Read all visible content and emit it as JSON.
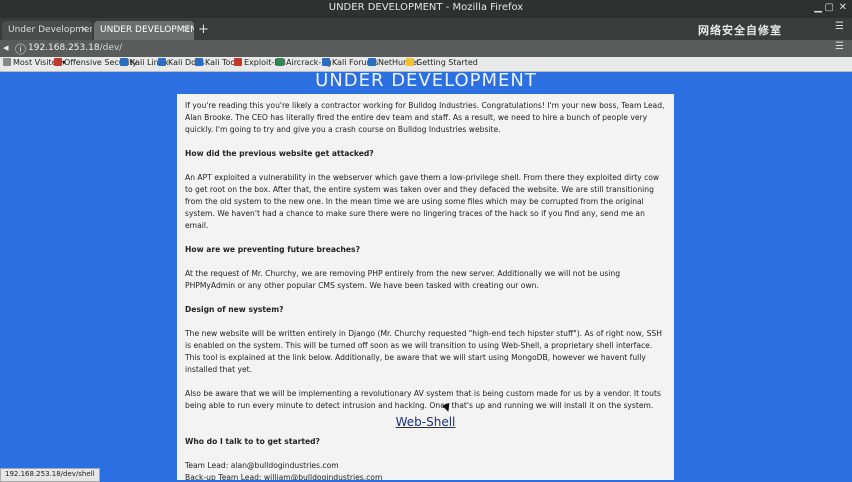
{
  "window": {
    "title": "UNDER DEVELOPMENT - Mozilla Firefox"
  },
  "tabs": [
    {
      "label": "Under Development"
    },
    {
      "label": "UNDER DEVELOPMENT"
    }
  ],
  "watermark": "网络安全自修室",
  "address": {
    "host": "192.168.253.18",
    "path": "/dev/"
  },
  "bookmarks": [
    {
      "label": "Most Visited▾",
      "icon": "gear-icon"
    },
    {
      "label": "Offensive Security",
      "icon": "offsec-icon"
    },
    {
      "label": "Kali Linux",
      "icon": "kali-icon"
    },
    {
      "label": "Kali Docs",
      "icon": "kali-icon"
    },
    {
      "label": "Kali Tools",
      "icon": "kali-icon"
    },
    {
      "label": "Exploit-DB",
      "icon": "exploitdb-icon"
    },
    {
      "label": "Aircrack-ng",
      "icon": "aircrack-icon"
    },
    {
      "label": "Kali Forums",
      "icon": "kali-icon"
    },
    {
      "label": "NetHunter",
      "icon": "kali-icon"
    },
    {
      "label": "Getting Started",
      "icon": "firefox-icon"
    }
  ],
  "page": {
    "heading": "UNDER DEVELOPMENT",
    "intro": "If you're reading this you're likely a contractor working for Bulldog Industries. Congratulations! I'm your new boss, Team Lead, Alan Brooke. The CEO has literally fired the entire dev team and staff. As a result, we need to hire a bunch of people very quickly. I'm going to try and give you a crash course on Bulldog Industries website.",
    "q1": "How did the previous website get attacked?",
    "a1": "An APT exploited a vulnerability in the webserver which gave them a low-privilege shell. From there they exploited dirty cow to get root on the box. After that, the entire system was taken over and they defaced the website. We are still transitioning from the old system to the new one. In the mean time we are using some files which may be corrupted from the original system. We haven't had a chance to make sure there were no lingering traces of the hack so if you find any, send me an email.",
    "q2": "How are we preventing future breaches?",
    "a2": "At the request of Mr. Churchy, we are removing PHP entirely from the new server. Additionally we will not be using PHPMyAdmin or any other popular CMS system. We have been tasked with creating our own.",
    "q3": "Design of new system?",
    "a3": "The new website will be written entirely in Django (Mr. Churchy requested \"high-end tech hipster stuff\"). As of right now, SSH is enabled on the system. This will be turned off soon as we will transition to using Web-Shell, a proprietary shell interface. This tool is explained at the link below. Additionally, be aware that we will start using MongoDB, however we havent fully installed that yet.",
    "a4": "Also be aware that we will be implementing a revolutionary AV system that is being custom made for us by a vendor. It touts being able to run every minute to detect intrusion and hacking. Once that's up and running we will install it on the system.",
    "link": "Web-Shell",
    "q5": "Who do I talk to to get started?",
    "contact1": "Team Lead: alan@bulldogindustries.com",
    "contact2": "Back-up Team Lead: william@bulldogindustries.com"
  },
  "status": {
    "url": "192.168.253.18/dev/shell"
  }
}
